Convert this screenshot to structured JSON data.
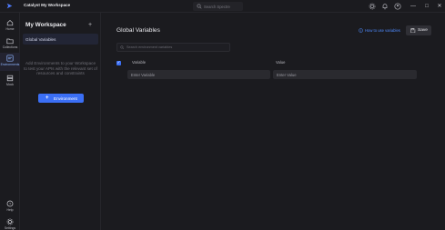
{
  "titlebar": {
    "workspace": "Catalyst My Workspace",
    "search_placeholder": "Search Spectre"
  },
  "rail": {
    "items": [
      {
        "label": "Home"
      },
      {
        "label": "Collections"
      },
      {
        "label": "Environments"
      },
      {
        "label": "Mock"
      }
    ],
    "bottom": [
      {
        "label": "Help"
      },
      {
        "label": "Settings"
      }
    ]
  },
  "panel": {
    "title": "My Workspace",
    "selected_item": "Global Variables",
    "empty_text": "Add Environments to your Workspace to test your APIs with the relevant set of resources and constraints",
    "add_button": "Environment"
  },
  "main": {
    "title": "Global Variables",
    "howto_link": "How to use variables",
    "save_label": "Save",
    "search_placeholder": "Search environment variables",
    "columns": {
      "variable": "Variable",
      "value": "Value"
    },
    "row": {
      "variable_placeholder": "Enter Variable",
      "value_placeholder": "Enter Value"
    }
  },
  "colors": {
    "accent": "#3b6ff5",
    "link": "#4f8bff",
    "background": "#1b1b1f"
  }
}
